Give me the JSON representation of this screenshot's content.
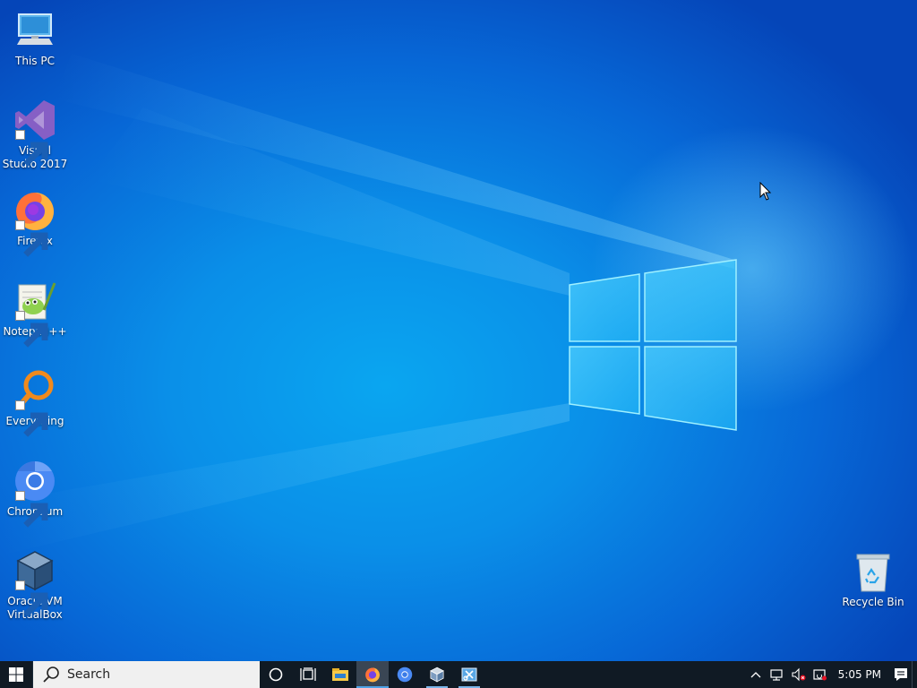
{
  "desktop": {
    "icons": [
      {
        "label": "This PC",
        "icon": "this-pc-icon"
      },
      {
        "label": "Visual Studio 2017",
        "icon": "visual-studio-icon"
      },
      {
        "label": "Firefox",
        "icon": "firefox-icon"
      },
      {
        "label": "Notepad++",
        "icon": "notepad-plus-plus-icon"
      },
      {
        "label": "Everything",
        "icon": "everything-icon"
      },
      {
        "label": "Chromium",
        "icon": "chromium-icon"
      },
      {
        "label": "Oracle VM VirtualBox",
        "icon": "virtualbox-icon"
      },
      {
        "label": "Recycle Bin",
        "icon": "recycle-bin-icon"
      }
    ]
  },
  "taskbar": {
    "search_placeholder": "Search",
    "apps": [
      {
        "icon": "cortana-icon"
      },
      {
        "icon": "task-view-icon"
      },
      {
        "icon": "file-explorer-icon"
      },
      {
        "icon": "firefox-icon",
        "active": true
      },
      {
        "icon": "chromium-icon"
      },
      {
        "icon": "virtualbox-icon"
      },
      {
        "icon": "snipping-tool-icon"
      }
    ],
    "tray": {
      "icons": [
        "chevron-up-icon",
        "network-icon",
        "volume-muted-icon",
        "battery-icon"
      ],
      "time": "5:05 PM"
    }
  },
  "colors": {
    "taskbar_bg": "#101a24",
    "active_underline": "#4ea2e6",
    "desktop_blue": "#0a8fe8"
  }
}
